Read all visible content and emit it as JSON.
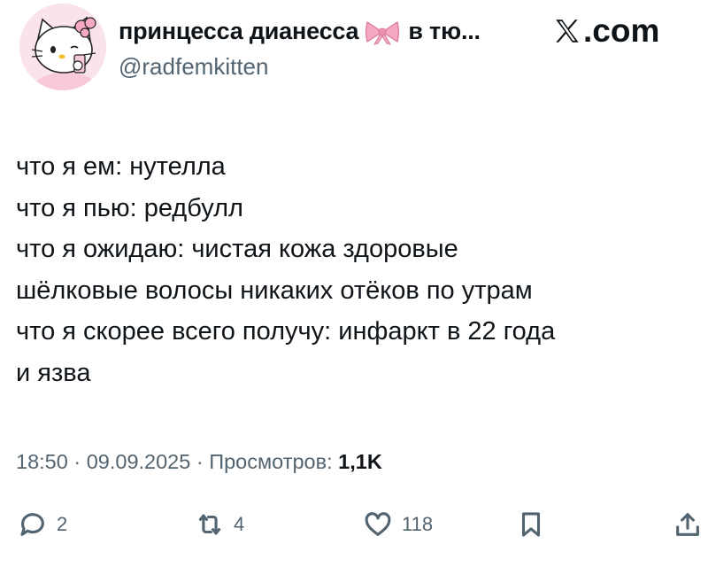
{
  "user": {
    "display_name": "принцесса дианесса",
    "display_name_suffix": "в тю...",
    "handle": "@radfemkitten",
    "avatar_icon": "hello-kitty-avatar",
    "name_emoji": "pink-bow-icon"
  },
  "brand": {
    "logo_text": ".com",
    "logo_icon": "x-logo-icon"
  },
  "tweet": {
    "lines": [
      "что я ем: нутелла",
      "что я пью: редбулл",
      "что я ожидаю: чистая кожа здоровые",
      "шёлковые волосы никаких отёков по утрам",
      "что я скорее всего получу: инфаркт в 22 года",
      "и язва"
    ],
    "time": "18:50",
    "date": "09.09.2025",
    "views_label": "Просмотров:",
    "views_count": "1,1K"
  },
  "actions": {
    "replies": "2",
    "reposts": "4",
    "likes": "118"
  },
  "colors": {
    "text": "#0f1419",
    "muted": "#536471",
    "bow": "#f4a7c0"
  }
}
